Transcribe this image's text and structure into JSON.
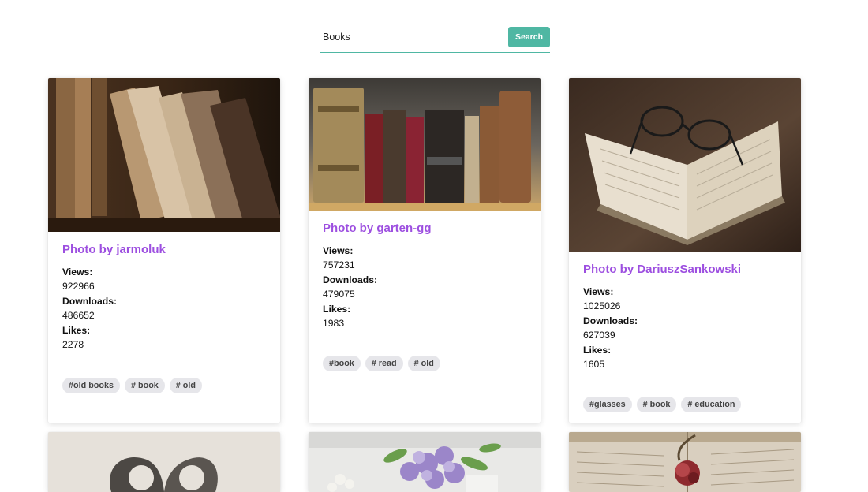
{
  "search": {
    "value": "Books",
    "button_label": "Search"
  },
  "colors": {
    "accent": "#4fb7a3",
    "title": "#9d4fe0",
    "tag_bg": "#e6e6ea"
  },
  "cards": [
    {
      "photographer": "Photo by jarmoluk",
      "image": "old-books-on-shelf",
      "views_label": "Views:",
      "views": "922966",
      "downloads_label": "Downloads:",
      "downloads": "486652",
      "likes_label": "Likes:",
      "likes": "2278",
      "tags": [
        "#old books",
        "# book",
        "# old"
      ]
    },
    {
      "photographer": "Photo by garten-gg",
      "image": "antique-book-spines",
      "views_label": "Views:",
      "views": "757231",
      "downloads_label": "Downloads:",
      "downloads": "479075",
      "likes_label": "Likes:",
      "likes": "1983",
      "tags": [
        "#book",
        "# read",
        "# old"
      ]
    },
    {
      "photographer": "Photo by DariuszSankowski",
      "image": "open-book-with-glasses",
      "views_label": "Views:",
      "views": "1025026",
      "downloads_label": "Downloads:",
      "downloads": "627039",
      "likes_label": "Likes:",
      "likes": "1605",
      "tags": [
        "#glasses",
        "# book",
        "# education"
      ]
    }
  ],
  "partial_cards": [
    {
      "image": "heart-shaped-book-pages"
    },
    {
      "image": "lilac-flowers-vase"
    },
    {
      "image": "dried-rose-on-book"
    }
  ]
}
